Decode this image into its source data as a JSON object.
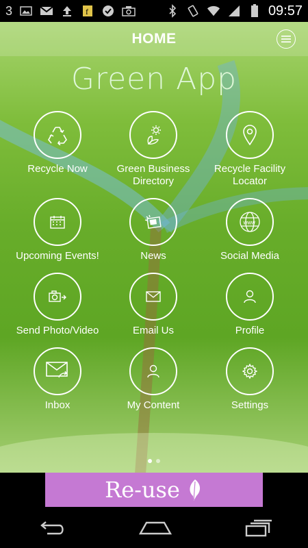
{
  "status_bar": {
    "signal_label": "3",
    "time": "09:57",
    "icons": [
      "image-icon",
      "gmail-icon",
      "upload-icon",
      "app-notification-icon",
      "check-icon",
      "camera-icon",
      "bluetooth-icon",
      "vibrate-icon",
      "wifi-icon",
      "signal-icon",
      "battery-icon"
    ]
  },
  "header": {
    "title": "HOME"
  },
  "app_title": "Green App",
  "tiles": [
    {
      "label": "Recycle Now",
      "icon": "recycle-icon"
    },
    {
      "label": "Green Business Directory",
      "icon": "leaf-sun-icon"
    },
    {
      "label": "Recycle Facility Locator",
      "icon": "location-pin-icon"
    },
    {
      "label": "Upcoming Events!",
      "icon": "calendar-icon"
    },
    {
      "label": "News",
      "icon": "newspaper-icon"
    },
    {
      "label": "Social Media",
      "icon": "globe-icon"
    },
    {
      "label": "Send Photo/Video",
      "icon": "camera-send-icon"
    },
    {
      "label": "Email Us",
      "icon": "envelope-icon"
    },
    {
      "label": "Profile",
      "icon": "person-icon"
    },
    {
      "label": "Inbox",
      "icon": "inbox-envelope-icon"
    },
    {
      "label": "My Content",
      "icon": "person-icon"
    },
    {
      "label": "Settings",
      "icon": "gear-icon"
    }
  ],
  "pager": {
    "pages": 2,
    "current": 1
  },
  "banner": {
    "text": "Re-use",
    "color": "#c579d3"
  },
  "colors": {
    "background_green": "#68ad2a",
    "header_overlay": "#ffffff"
  }
}
